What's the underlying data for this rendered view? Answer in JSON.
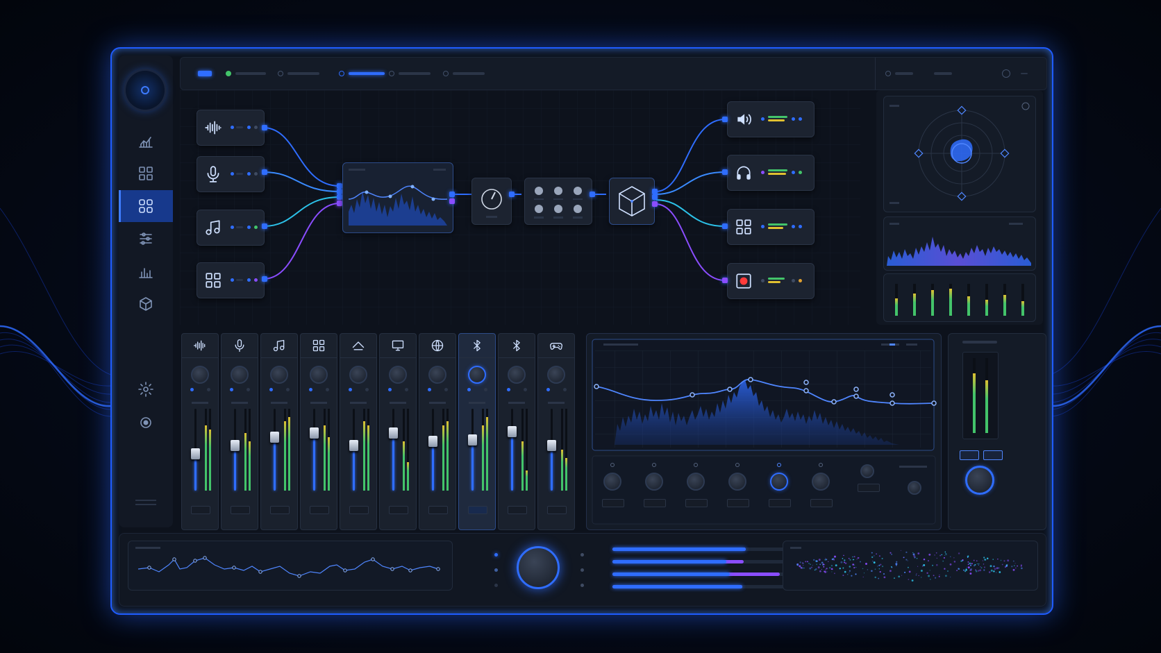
{
  "colors": {
    "accent": "#2f6dff",
    "accent_glow": "#4f86ff",
    "purple": "#8a4dff",
    "green": "#43c46a",
    "yellow": "#e0c030",
    "record": "#ff3b3b",
    "cyan": "#2cc1e8"
  },
  "sidebar": {
    "logo_icon": "knob-logo-icon",
    "items": [
      {
        "icon": "analytics-icon",
        "active": false
      },
      {
        "icon": "grid-icon",
        "active": false
      },
      {
        "icon": "routing-icon",
        "active": true
      },
      {
        "icon": "sliders-icon",
        "active": false
      },
      {
        "icon": "bar-chart-icon",
        "active": false
      },
      {
        "icon": "cube-icon",
        "active": false
      },
      {
        "icon": "settings-icon",
        "active": false
      },
      {
        "icon": "record-icon",
        "active": false
      }
    ]
  },
  "inputs": [
    {
      "icon": "waveform-icon"
    },
    {
      "icon": "microphone-icon"
    },
    {
      "icon": "music-note-icon"
    },
    {
      "icon": "apps-grid-icon"
    }
  ],
  "outputs": [
    {
      "icon": "speaker-icon",
      "level": 0.7
    },
    {
      "icon": "headphones-icon",
      "level": 0.8
    },
    {
      "icon": "apps-grid-icon",
      "level": 0.75
    },
    {
      "icon": "record-icon",
      "level": 0.6
    }
  ],
  "channels": [
    {
      "icon": "waveform-icon",
      "fader": 0.45,
      "meter_l": 0.8,
      "meter_r": 0.75,
      "selected": false
    },
    {
      "icon": "microphone-icon",
      "fader": 0.55,
      "meter_l": 0.7,
      "meter_r": 0.6,
      "selected": false
    },
    {
      "icon": "music-note-icon",
      "fader": 0.65,
      "meter_l": 0.85,
      "meter_r": 0.9,
      "selected": false
    },
    {
      "icon": "grid-icon",
      "fader": 0.7,
      "meter_l": 0.8,
      "meter_r": 0.65,
      "selected": false
    },
    {
      "icon": "cloud-icon",
      "fader": 0.55,
      "meter_l": 0.85,
      "meter_r": 0.8,
      "selected": false
    },
    {
      "icon": "monitor-icon",
      "fader": 0.7,
      "meter_l": 0.6,
      "meter_r": 0.35,
      "selected": false
    },
    {
      "icon": "globe-icon",
      "fader": 0.6,
      "meter_l": 0.8,
      "meter_r": 0.85,
      "selected": false
    },
    {
      "icon": "bluetooth-icon",
      "fader": 0.62,
      "meter_l": 0.8,
      "meter_r": 0.9,
      "selected": true
    },
    {
      "icon": "bluetooth-icon",
      "fader": 0.72,
      "meter_l": 0.6,
      "meter_r": 0.25,
      "selected": false
    },
    {
      "icon": "gamepad-icon",
      "fader": 0.55,
      "meter_l": 0.5,
      "meter_r": 0.4,
      "selected": false
    }
  ],
  "master": {
    "meter_l": 0.8,
    "meter_r": 0.7
  },
  "output_meters": [
    0.55,
    0.7,
    0.8,
    0.85,
    0.6,
    0.5,
    0.65,
    0.45
  ],
  "bottom_bars": [
    {
      "blue": 0.75,
      "purple": 0
    },
    {
      "blue": 0.64,
      "purple": 0.1
    },
    {
      "blue": 0.66,
      "purple": 0.28
    },
    {
      "blue": 0.73,
      "purple": 0
    }
  ]
}
